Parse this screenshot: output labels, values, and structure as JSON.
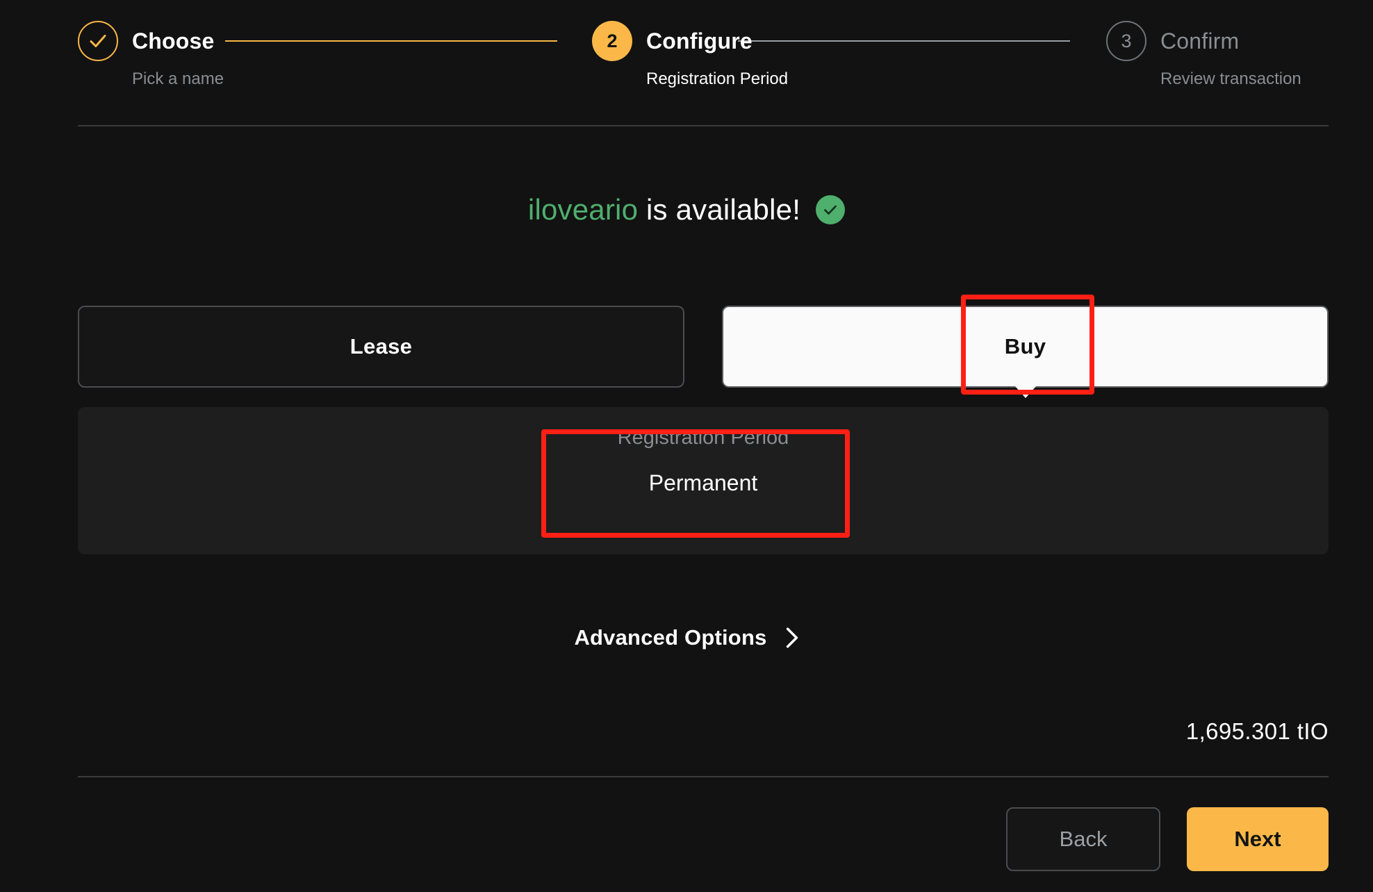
{
  "stepper": {
    "steps": [
      {
        "marker": "check-icon",
        "title": "Choose",
        "subtitle": "Pick a name",
        "state": "done"
      },
      {
        "marker": "2",
        "title": "Configure",
        "subtitle": "Registration Period",
        "state": "active"
      },
      {
        "marker": "3",
        "title": "Confirm",
        "subtitle": "Review transaction",
        "state": "pending"
      }
    ]
  },
  "availability": {
    "name": "iloveario",
    "message": " is available!",
    "badge_icon": "check-circle-icon"
  },
  "tenure": {
    "lease_label": "Lease",
    "buy_label": "Buy",
    "selected": "Buy"
  },
  "period": {
    "label": "Registration Period",
    "value": "Permanent"
  },
  "advanced": {
    "label": "Advanced Options",
    "icon": "chevron-right-icon"
  },
  "price": {
    "amount": "1,695.301 tIO"
  },
  "footer": {
    "back_label": "Back",
    "next_label": "Next"
  },
  "colors": {
    "page_background": "#121212",
    "panel_background": "#1E1E1E",
    "accent_orange": "#FBB848",
    "available_green": "#4FAF6D",
    "muted_text": "#8A8D92",
    "annotation_red": "#FF2015",
    "selected_white": "#FAFAFA"
  }
}
